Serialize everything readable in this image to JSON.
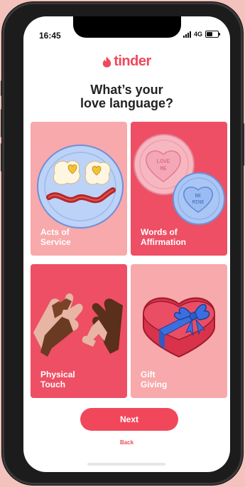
{
  "status_bar": {
    "time": "16:45",
    "network": "4G",
    "battery_level": 0.6
  },
  "app": {
    "logo_text": "tinder",
    "brand_color": "#f0485a"
  },
  "quiz": {
    "question_line1": "What’s your",
    "question_line2": "love language?",
    "options": [
      {
        "line1": "Acts of",
        "line2": "Service"
      },
      {
        "line1": "Words of",
        "line2": "Affirmation"
      },
      {
        "line1": "Physical",
        "line2": "Touch"
      },
      {
        "line1": "Gift",
        "line2": "Giving"
      }
    ],
    "candy_text_1_line1": "LOVE",
    "candy_text_1_line2": "ME",
    "candy_text_2_line1": "BE",
    "candy_text_2_line2": "MINE"
  },
  "actions": {
    "next_label": "Next",
    "back_label": "Back"
  }
}
